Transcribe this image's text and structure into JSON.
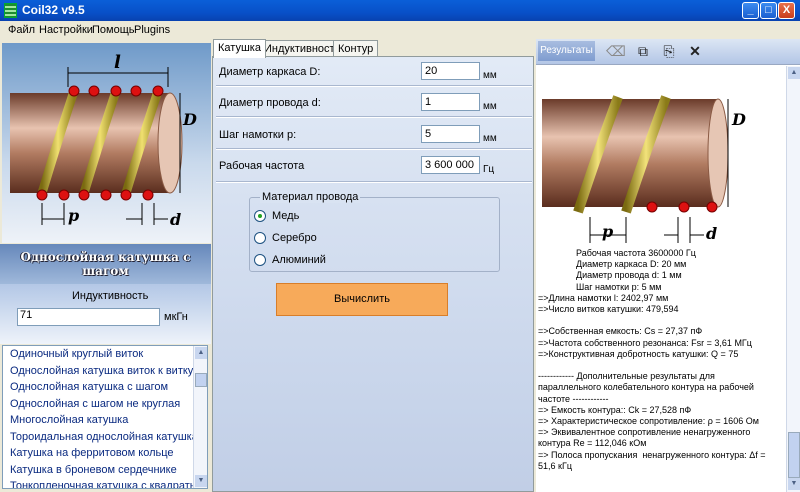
{
  "window": {
    "title": "Coil32 v9.5",
    "minimize": "_",
    "maximize": "□",
    "close": "X"
  },
  "menu": [
    "Файл",
    "Настройки",
    "Помощь",
    "Plugins"
  ],
  "left": {
    "coil_labels": {
      "length": "l",
      "diameter": "D",
      "pitch": "p",
      "wire": "d"
    },
    "caption": "Однослойная катушка с шагом",
    "inductance_label": "Индуктивность",
    "inductance_value": "71",
    "inductance_unit": "мкГн",
    "list": [
      "Одиночный круглый виток",
      "Однослойная катушка виток к витку",
      "Однослойная катушка с шагом",
      "Однослойная с шагом не круглая",
      "Многослойная катушка",
      "Тороидальная однослойная катушка",
      "Катушка на ферритовом кольце",
      "Катушка в броневом сердечнике",
      "Тонкопленочная катушка с квадратными ..."
    ]
  },
  "center": {
    "tabs": [
      "Катушка",
      "Индуктивность",
      "Контур"
    ],
    "fields": [
      {
        "label": "Диаметр каркаса D:",
        "value": "20",
        "unit": "мм"
      },
      {
        "label": "Диаметр провода d:",
        "value": "1",
        "unit": "мм"
      },
      {
        "label": "Шаг намотки p:",
        "value": "5",
        "unit": "мм"
      },
      {
        "label": "Рабочая частота",
        "value": "3 600 000",
        "unit": "Гц"
      }
    ],
    "material_legend": "Материал провода",
    "materials": [
      "Медь",
      "Серебро",
      "Алюминий"
    ],
    "material_selected": 0,
    "calc_button": "Вычислить"
  },
  "right": {
    "results_button": "Результаты",
    "coil_labels": {
      "diameter": "D",
      "pitch": "p",
      "wire": "d"
    },
    "results_indented": [
      "Рабочая частота 3600000 Гц",
      "Диаметр каркаса D: 20 мм",
      "Диаметр провода d: 1 мм",
      "Шаг намотки p: 5 мм"
    ],
    "results_lines": [
      "=>Длина намотки l: 2402,97 мм",
      "=>Число витков катушки: 479,594",
      "",
      "=>Собственная емкость: Cs = 27,37 пФ",
      "=>Частота собственного резонанса: Fsr = 3,61 МГц",
      "=>Конструктивная добротность катушки: Q = 75",
      "",
      "------------ Дополнительные результаты для",
      "параллельного колебательного контура на рабочей",
      "частоте ------------",
      "=> Емкость контура:: Ck = 27,528 пФ",
      "=> Характеристическое сопротивление: ρ = 1606 Ом",
      "=> Эквивалентное сопротивление ненагруженного",
      "контура Re = 112,046 кОм",
      "=> Полоса пропускания  ненагруженного контура: Δf =",
      "51,6 кГц"
    ]
  }
}
